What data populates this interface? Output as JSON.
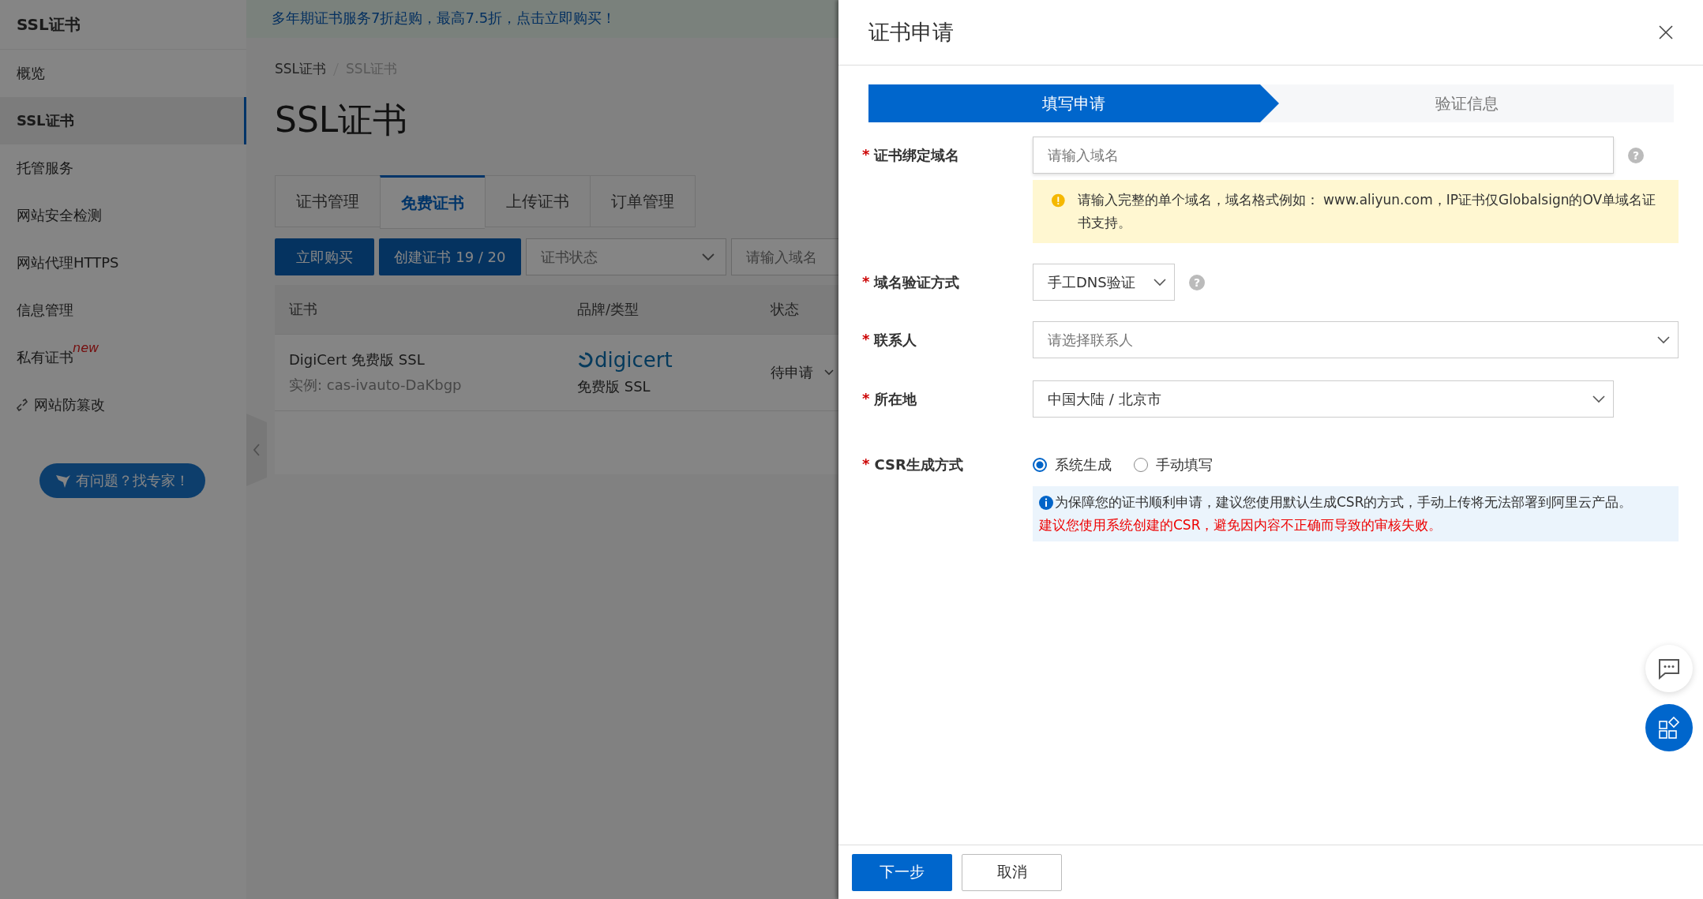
{
  "sidebar": {
    "title": "SSL证书",
    "items": [
      {
        "label": "概览",
        "selected": false,
        "kind": "plain"
      },
      {
        "label": "SSL证书",
        "selected": true,
        "kind": "plain"
      },
      {
        "label": "托管服务",
        "selected": false,
        "kind": "plain"
      },
      {
        "label": "网站安全检测",
        "selected": false,
        "kind": "plain"
      },
      {
        "label": "网站代理HTTPS",
        "selected": false,
        "kind": "plain"
      },
      {
        "label": "信息管理",
        "selected": false,
        "kind": "plain"
      },
      {
        "label": "私有证书",
        "selected": false,
        "kind": "plain",
        "badge": "new"
      },
      {
        "label": "网站防篡改",
        "selected": false,
        "kind": "linked"
      }
    ],
    "help_button": "有问题？找专家！"
  },
  "banner": "多年期证书服务7折起购，最高7.5折，点击立即购买！",
  "breadcrumb": [
    "SSL证书",
    "SSL证书"
  ],
  "page_title": "SSL证书",
  "tabs": [
    {
      "label": "证书管理",
      "selected": false
    },
    {
      "label": "免费证书",
      "selected": true
    },
    {
      "label": "上传证书",
      "selected": false
    },
    {
      "label": "订单管理",
      "selected": false
    }
  ],
  "toolbar": {
    "buy_button": "立即购买",
    "create_button": "创建证书 19 / 20",
    "status_select": "证书状态",
    "search": {
      "placeholder": "请输入域名"
    }
  },
  "table": {
    "columns": [
      "证书",
      "品牌/类型",
      "状态"
    ],
    "rows": [
      {
        "name": "DigiCert 免费版 SSL",
        "instance": "实例: cas-ivauto-DaKbgp",
        "brand": "digicert",
        "type": "免费版 SSL",
        "status": "待申请"
      }
    ]
  },
  "drawer": {
    "title": "证书申请",
    "steps": [
      {
        "label": "填写申请",
        "selected": true
      },
      {
        "label": "验证信息",
        "selected": false
      }
    ],
    "form": [
      {
        "kind": "input",
        "mark": "*",
        "label": "证书绑定域名",
        "placeholder": "请输入域名",
        "help": "?",
        "note": {
          "kind": "warning",
          "text": "请输入完整的单个域名，域名格式例如： www.aliyun.com，IP证书仅Globalsign的OV单域名证书支持。"
        }
      },
      {
        "kind": "select",
        "mark": "*",
        "label": "域名验证方式",
        "value": "手工DNS验证",
        "help": "?"
      },
      {
        "kind": "select",
        "mark": "*",
        "label": "联系人",
        "placeholder": "请选择联系人"
      },
      {
        "kind": "select",
        "mark": "*",
        "label": "所在地",
        "value": "中国大陆 / 北京市"
      },
      {
        "kind": "radio",
        "mark": "*",
        "label": "CSR生成方式",
        "options": [
          {
            "label": "系统生成",
            "selected": true
          },
          {
            "label": "手动填写",
            "selected": false
          }
        ],
        "note": {
          "kind": "info",
          "text": "为保障您的证书顺利申请，建议您使用默认生成CSR的方式，手动上传将无法部署到阿里云产品。",
          "emphasis": "建议您使用系统创建的CSR，避免因内容不正确而导致的审核失败。"
        }
      }
    ],
    "buttons": [
      {
        "label": "下一步",
        "kind": "primary"
      },
      {
        "label": "取消",
        "kind": "normal"
      }
    ]
  }
}
